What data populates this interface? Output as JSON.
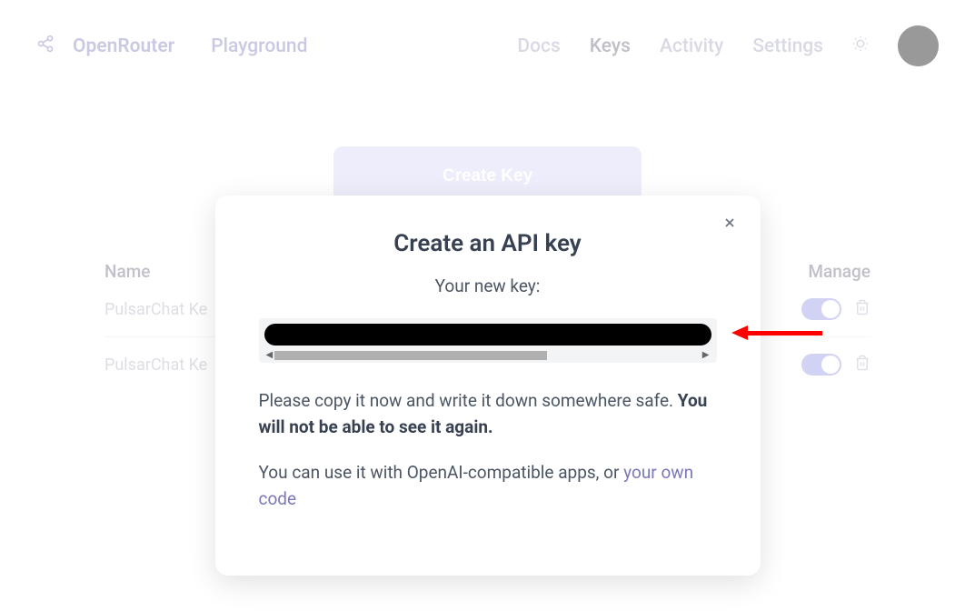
{
  "header": {
    "brand": "OpenRouter",
    "playground": "Playground",
    "nav": {
      "docs": "Docs",
      "keys": "Keys",
      "activity": "Activity",
      "settings": "Settings"
    }
  },
  "main": {
    "create_button_label": "Create Key",
    "table": {
      "header_name": "Name",
      "header_manage": "Manage",
      "rows": [
        {
          "name": "PulsarChat Ke"
        },
        {
          "name": "PulsarChat Ke"
        }
      ]
    }
  },
  "modal": {
    "title": "Create an API key",
    "subtitle": "Your new key:",
    "warning_prefix": "Please copy it now and write it down somewhere safe. ",
    "warning_bold": "You will not be able to see it again.",
    "usage_prefix": "You can use it with OpenAI-compatible apps, or ",
    "usage_link": "your own code"
  }
}
